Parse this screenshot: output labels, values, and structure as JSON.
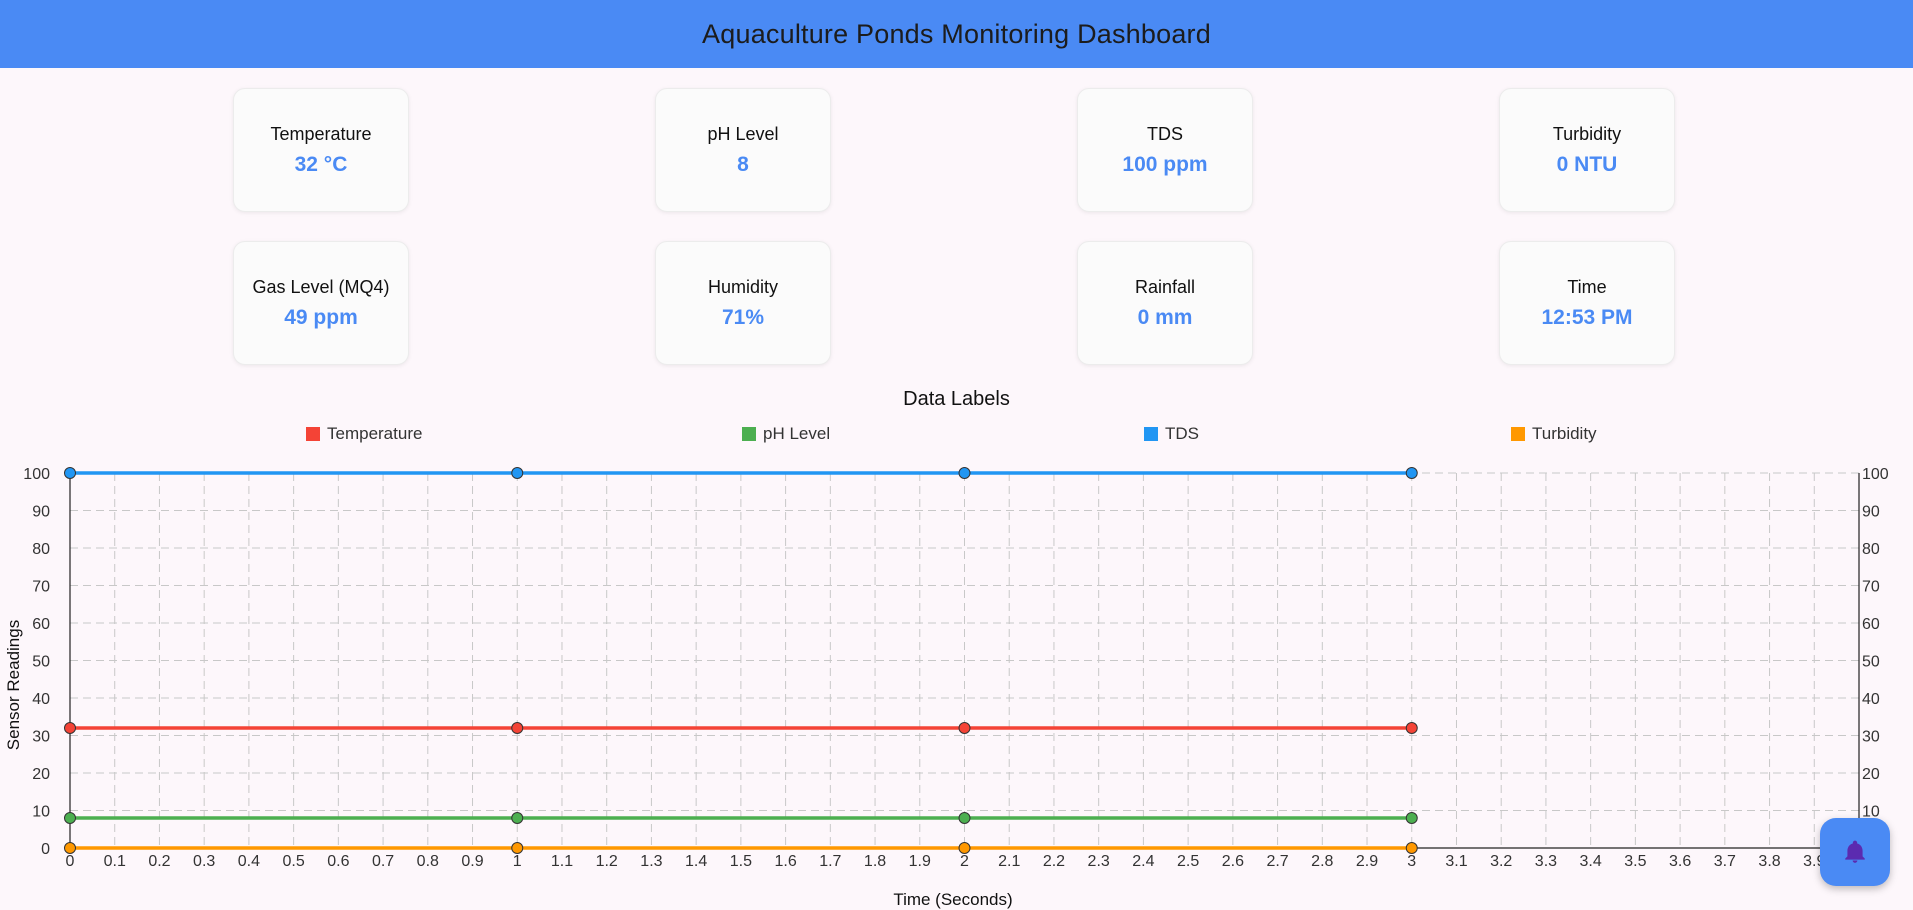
{
  "header": {
    "title": "Aquaculture Ponds Monitoring Dashboard"
  },
  "cards": [
    {
      "label": "Temperature",
      "value": "32 °C"
    },
    {
      "label": "pH Level",
      "value": "8"
    },
    {
      "label": "TDS",
      "value": "100 ppm"
    },
    {
      "label": "Turbidity",
      "value": "0 NTU"
    },
    {
      "label": "Gas Level (MQ4)",
      "value": "49 ppm"
    },
    {
      "label": "Humidity",
      "value": "71%"
    },
    {
      "label": "Rainfall",
      "value": "0 mm"
    },
    {
      "label": "Time",
      "value": "12:53 PM"
    }
  ],
  "colors": {
    "accent": "#4a8af4",
    "temperature": "#f44336",
    "ph": "#4caf50",
    "tds": "#2196f3",
    "turbidity": "#ff9800"
  },
  "fab": {
    "icon": "bell-icon"
  },
  "chart_data": {
    "type": "line",
    "title": "Data Labels",
    "xlabel": "Time (Seconds)",
    "ylabel": "Sensor Readings",
    "xlim": [
      0,
      4
    ],
    "ylim": [
      0,
      100
    ],
    "grid": true,
    "legend": "top",
    "y_ticks": [
      0,
      10,
      20,
      30,
      40,
      50,
      60,
      70,
      80,
      90,
      100
    ],
    "x_ticks": [
      "0",
      "0.1",
      "0.2",
      "0.3",
      "0.4",
      "0.5",
      "0.6",
      "0.7",
      "0.8",
      "0.9",
      "1",
      "1.1",
      "1.2",
      "1.3",
      "1.4",
      "1.5",
      "1.6",
      "1.7",
      "1.8",
      "1.9",
      "2",
      "2.1",
      "2.2",
      "2.3",
      "2.4",
      "2.5",
      "2.6",
      "2.7",
      "2.8",
      "2.9",
      "3",
      "3.1",
      "3.2",
      "3.3",
      "3.4",
      "3.5",
      "3.6",
      "3.7",
      "3.8",
      "3.9"
    ],
    "x": [
      0,
      1,
      2,
      3
    ],
    "series": [
      {
        "name": "Temperature",
        "values": [
          32,
          32,
          32,
          32
        ]
      },
      {
        "name": "pH Level",
        "values": [
          8,
          8,
          8,
          8
        ]
      },
      {
        "name": "TDS",
        "values": [
          100,
          100,
          100,
          100
        ]
      },
      {
        "name": "Turbidity",
        "values": [
          0,
          0,
          0,
          0
        ]
      }
    ]
  }
}
